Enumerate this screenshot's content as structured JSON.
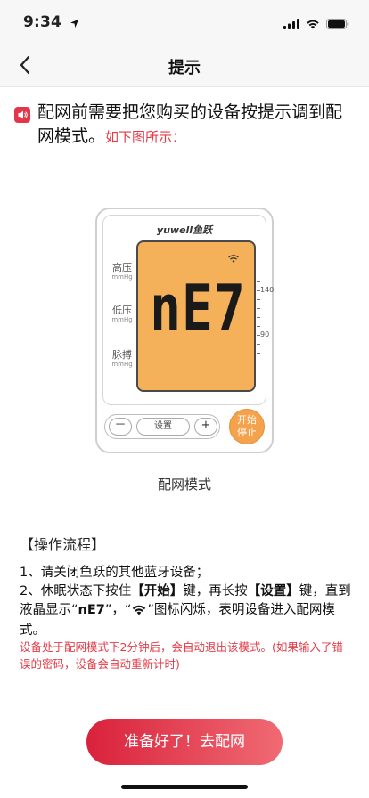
{
  "status": {
    "time": "9:34"
  },
  "nav": {
    "title": "提示"
  },
  "intro": {
    "main": "配网前需要把您购买的设备按提示调到配网模式。",
    "hint": "如下图所示："
  },
  "device": {
    "brand": "yuwell鱼跃",
    "display": "nE7",
    "labels": [
      {
        "main": "高压",
        "unit": "mmHg"
      },
      {
        "main": "低压",
        "unit": "mmHg"
      },
      {
        "main": "脉搏",
        "unit": "mmHg"
      }
    ],
    "scale": [
      "140",
      "90"
    ],
    "buttons": {
      "minus": "－",
      "set": "设置",
      "plus": "+",
      "start_line1": "开始",
      "start_line2": "停止"
    },
    "caption": "配网模式"
  },
  "procedure": {
    "title": "【操作流程】",
    "step1": "1、请关闭鱼跃的其他蓝牙设备；",
    "step2_pre": "2、休眠状态下按住",
    "step2_key1": "【开始】",
    "step2_mid": "键，再长按",
    "step2_key2": "【设置】",
    "step2_mid2": "键，直到液晶显示“",
    "step2_code": "nE7",
    "step2_mid3": "”，“",
    "step2_post": "”图标闪烁，表明设备进入配网模式。",
    "warning": "设备处于配网模式下2分钟后，会自动退出该模式。(如果输入了错误的密码，设备会自动重新计时)"
  },
  "cta": {
    "label": "准备好了！去配网"
  },
  "colors": {
    "accent": "#e33b47",
    "screen": "#f5b15a",
    "start_button": "#f5a24c"
  },
  "icons": {
    "back": "chevron-left-icon",
    "speaker": "speaker-icon",
    "wifi": "wifi-icon"
  }
}
